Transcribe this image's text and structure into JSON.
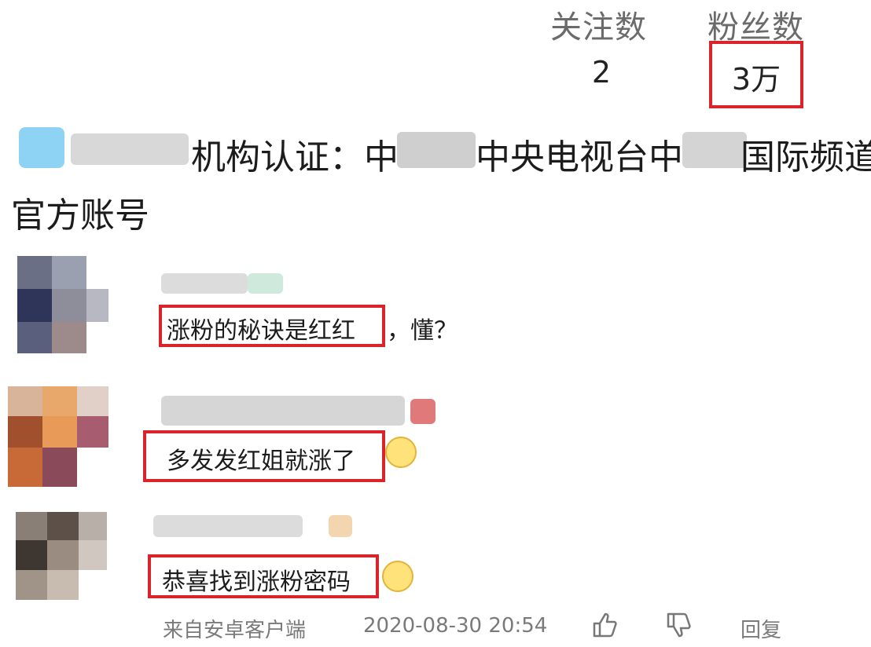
{
  "stats": {
    "following_label": "关注数",
    "following_value": "2",
    "followers_label": "粉丝数",
    "followers_value": "3万"
  },
  "certification": {
    "text_a": "机构认证：中",
    "text_b": "中央电视台中",
    "text_c": "国际频道",
    "line2": "官方账号"
  },
  "comments": [
    {
      "text": "涨粉的秘诀是红红",
      "suffix": "，懂？"
    },
    {
      "text": "多发发红姐就涨了",
      "emoji": "grinning-emoji-icon"
    },
    {
      "text": "恭喜找到涨粉密码",
      "emoji": "smiling-emoji-icon"
    }
  ],
  "footer": {
    "source": "来自安卓客户端",
    "timestamp": "2020-08-30 20:54",
    "reply_label": "回复"
  },
  "colors": {
    "highlight_border": "#d9242c",
    "text": "#1c1c1c",
    "muted": "#7a7a7a"
  }
}
